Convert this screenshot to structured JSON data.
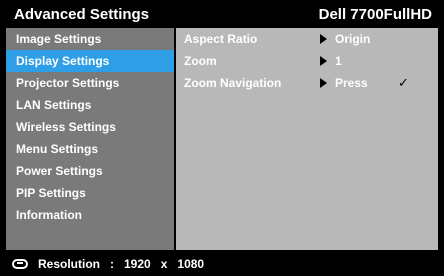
{
  "header": {
    "title": "Advanced Settings",
    "model": "Dell 7700FullHD"
  },
  "sidebar": {
    "items": [
      {
        "label": "Image Settings"
      },
      {
        "label": "Display Settings",
        "active": true
      },
      {
        "label": "Projector Settings"
      },
      {
        "label": "LAN Settings"
      },
      {
        "label": "Wireless Settings"
      },
      {
        "label": "Menu Settings"
      },
      {
        "label": "Power Settings"
      },
      {
        "label": "PIP Settings"
      },
      {
        "label": "Information"
      }
    ]
  },
  "panel": {
    "rows": [
      {
        "label": "Aspect Ratio",
        "value": "Origin"
      },
      {
        "label": "Zoom",
        "value": "1"
      },
      {
        "label": "Zoom Navigation",
        "value": "Press",
        "checked": "✓"
      }
    ]
  },
  "footer": {
    "label": "Resolution",
    "sep": ":",
    "width": "1920",
    "x": "x",
    "height": "1080"
  },
  "colors": {
    "background": "#000000",
    "sidebar": "#7a7a7a",
    "active": "#2e9fe6",
    "panel": "#b8b8b8"
  }
}
